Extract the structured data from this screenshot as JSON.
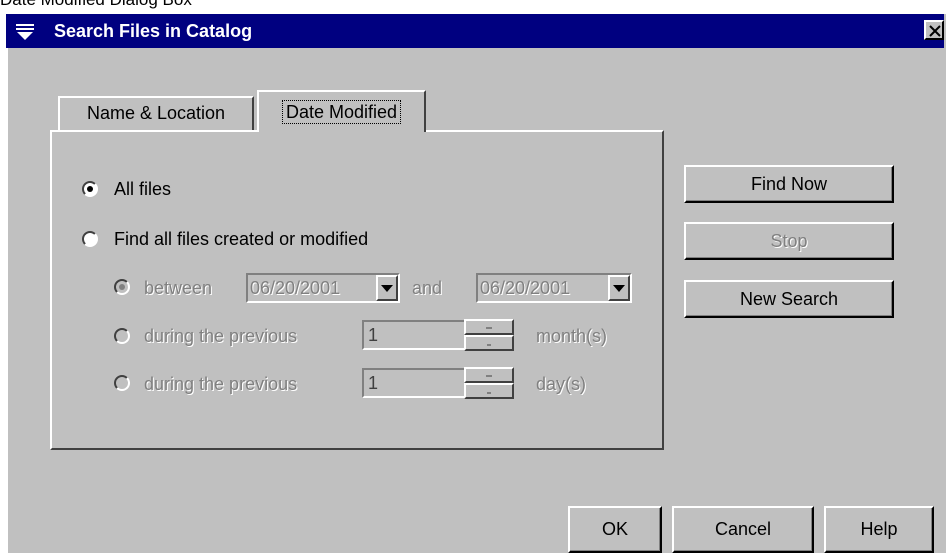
{
  "caption": "Date Modified Dialog Box",
  "window": {
    "title": "Search Files in Catalog",
    "close_glyph": "✕"
  },
  "tabs": [
    {
      "label": "Name & Location",
      "selected": false
    },
    {
      "label": "Date Modified",
      "selected": true
    }
  ],
  "options": {
    "all_files": {
      "label": "All files",
      "checked": true
    },
    "find_created": {
      "label": "Find all files created or modified",
      "checked": false
    },
    "between": {
      "label": "between",
      "from_date": "06/20/2001",
      "and_label": "and",
      "to_date": "06/20/2001",
      "checked": true,
      "enabled": false
    },
    "months": {
      "label": "during the previous",
      "value": "1",
      "unit": "month(s)",
      "enabled": false
    },
    "days": {
      "label": "during the previous",
      "value": "1",
      "unit": "day(s)",
      "enabled": false
    }
  },
  "side_buttons": {
    "find_now": "Find Now",
    "stop": "Stop",
    "new_search": "New Search"
  },
  "bottom_buttons": {
    "ok": "OK",
    "cancel": "Cancel",
    "help": "Help"
  },
  "colors": {
    "face": "#c0c0c0",
    "titlebar": "#000080",
    "disabled_text": "#808080"
  }
}
